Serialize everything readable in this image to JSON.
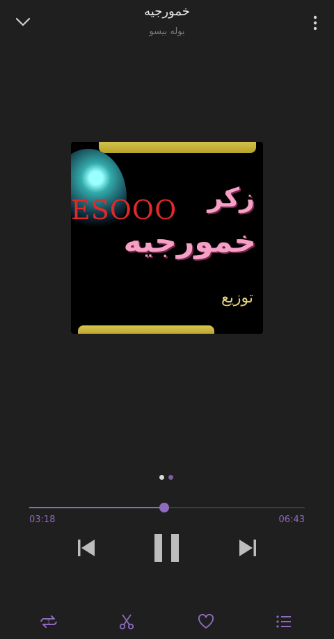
{
  "header": {
    "title": "خمورجيه",
    "artist": "بوله بيسو"
  },
  "cover": {
    "brand_text": "ESOOO",
    "word_zikr": "زكر",
    "word_big": "خمورجيه",
    "word_dist": "توزيع"
  },
  "pager": {
    "count": 2,
    "active_index": 0
  },
  "player": {
    "current_time": "03:18",
    "total_time": "06:43",
    "progress_fraction": 0.49
  },
  "icons": {
    "collapse": "chevron-down-icon",
    "more": "more-vertical-icon",
    "prev": "skip-previous-icon",
    "pause": "pause-icon",
    "next": "skip-next-icon",
    "repeat": "repeat-one-icon",
    "cut": "scissors-icon",
    "favorite": "heart-icon",
    "queue": "queue-list-icon"
  },
  "colors": {
    "accent": "#8e6bbf",
    "background": "#1f1f1f",
    "text": "#eaeaea",
    "muted": "#7d7d7d"
  }
}
